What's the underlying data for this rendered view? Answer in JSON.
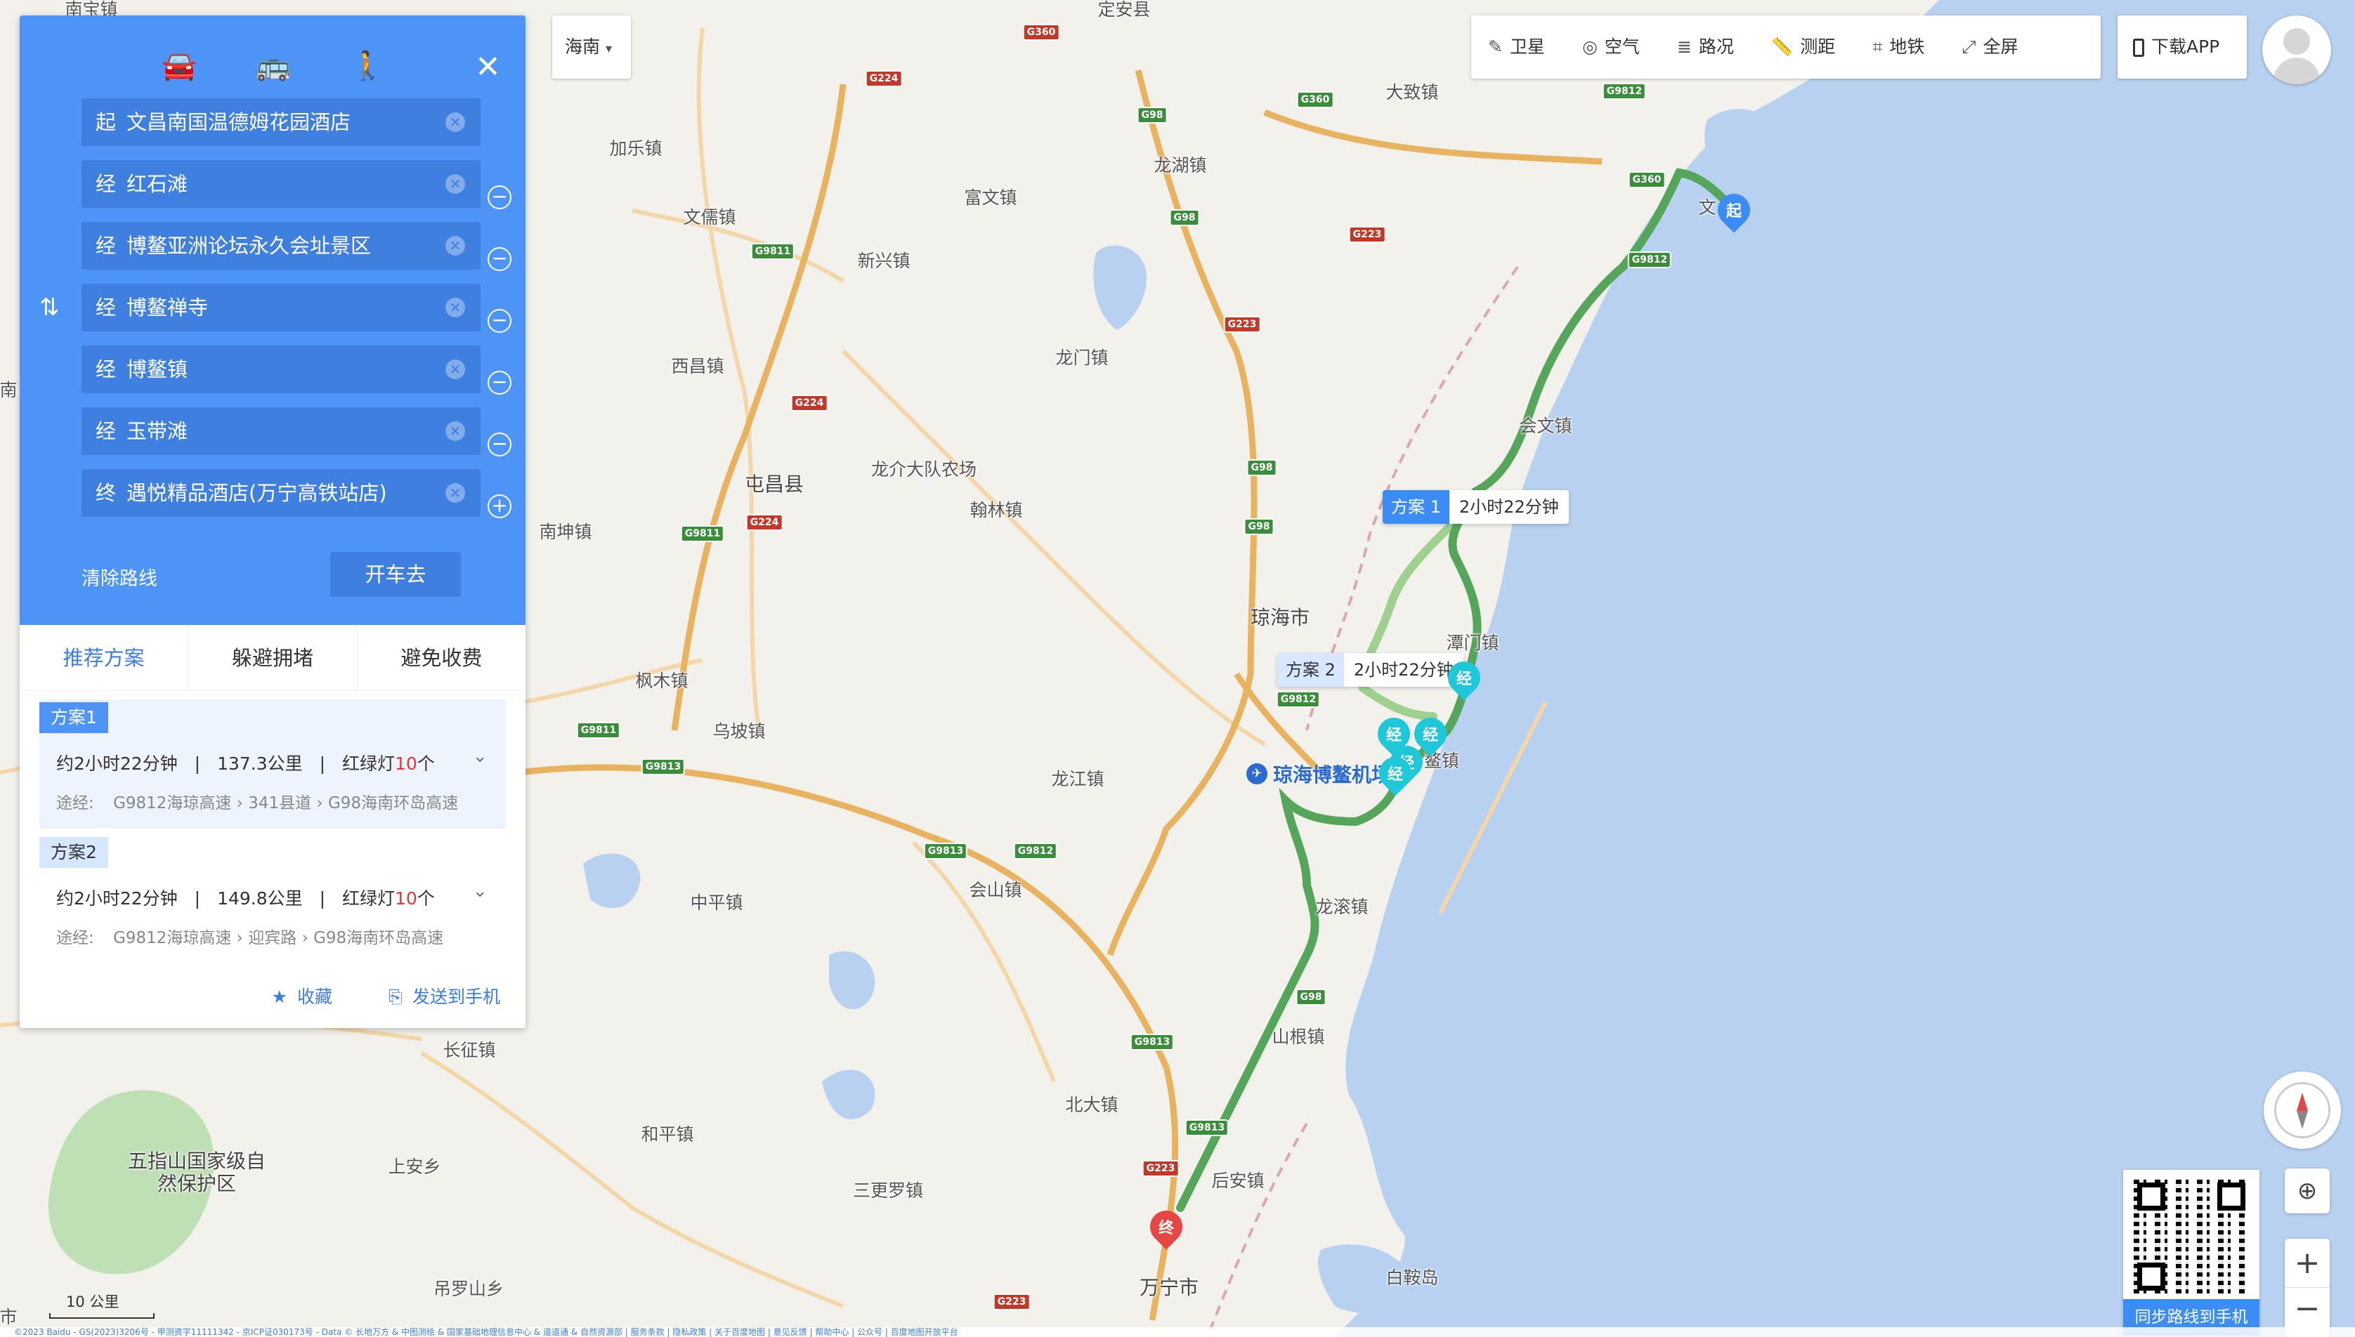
{
  "region_selector": {
    "label": "海南",
    "caret": "▾"
  },
  "toolbar": [
    {
      "label": "卫星",
      "icon": "satellite-icon",
      "glyph": "✎"
    },
    {
      "label": "空气",
      "icon": "air-quality-icon",
      "glyph": "◎"
    },
    {
      "label": "路况",
      "icon": "traffic-icon",
      "glyph": "≣"
    },
    {
      "label": "测距",
      "icon": "ruler-icon",
      "glyph": "📏"
    },
    {
      "label": "地铁",
      "icon": "subway-icon",
      "glyph": "⌗"
    },
    {
      "label": "全屏",
      "icon": "fullscreen-icon",
      "glyph": "⤢"
    }
  ],
  "download_app": "下载APP",
  "panel": {
    "modes": [
      "car",
      "bus",
      "walk"
    ],
    "stops": [
      {
        "prefix": "起",
        "name": "文昌南国温德姆花园酒店",
        "action": ""
      },
      {
        "prefix": "经",
        "name": "红石滩",
        "action": "−"
      },
      {
        "prefix": "经",
        "name": "博鳌亚洲论坛永久会址景区",
        "action": "−"
      },
      {
        "prefix": "经",
        "name": "博鳌禅寺",
        "action": "−"
      },
      {
        "prefix": "经",
        "name": "博鳌镇",
        "action": "−"
      },
      {
        "prefix": "经",
        "name": "玉带滩",
        "action": "−"
      },
      {
        "prefix": "终",
        "name": "遇悦精品酒店(万宁高铁站店)",
        "action": "+"
      }
    ],
    "clear_label": "清除路线",
    "go_label": "开车去",
    "tabs": [
      "推荐方案",
      "躲避拥堵",
      "避免收费"
    ],
    "plans": [
      {
        "badge": "方案1",
        "time": "约2小时22分钟",
        "distance": "137.3公里",
        "lights_prefix": "红绿灯",
        "lights": "10",
        "lights_suffix": "个",
        "via_label": "途经:",
        "via": [
          "G9812海琼高速",
          "341县道",
          "G98海南环岛高速"
        ]
      },
      {
        "badge": "方案2",
        "time": "约2小时22分钟",
        "distance": "149.8公里",
        "lights_prefix": "红绿灯",
        "lights": "10",
        "lights_suffix": "个",
        "via_label": "途经:",
        "via": [
          "G9812海琼高速",
          "迎宾路",
          "G98海南环岛高速"
        ]
      }
    ],
    "favorite_label": "收藏",
    "send_label": "发送到手机"
  },
  "route_tags": [
    {
      "name": "方案 1",
      "time": "2小时22分钟"
    },
    {
      "name": "方案 2",
      "time": "2小时22分钟"
    }
  ],
  "markers": {
    "start": "起",
    "end": "终",
    "via": "经"
  },
  "place_labels": [
    "南宝镇",
    "定安县",
    "大致镇",
    "加乐镇",
    "富文镇",
    "文儒镇",
    "龙湖镇",
    "新兴镇",
    "文",
    "西昌镇",
    "龙门镇",
    "会文镇",
    "屯昌县",
    "龙介大队农场",
    "翰林镇",
    "南坤镇",
    "琼海市",
    "潭门镇",
    "枫木镇",
    "乌坡镇",
    "龙江镇",
    "中平镇",
    "会山镇",
    "龙滚镇",
    "山根镇",
    "长征镇",
    "北大镇",
    "和平镇",
    "上安乡",
    "三更罗镇",
    "后安镇",
    "万宁市",
    "白鞍岛",
    "吊罗山乡",
    "五指山国家级自然保护区",
    "鳌镇",
    "南",
    "市"
  ],
  "airport_label": "琼海博鳌机场",
  "road_shields": [
    "G360",
    "G224",
    "G98",
    "G360",
    "G9812",
    "G360",
    "G9811",
    "G223",
    "G98",
    "G9812",
    "G224",
    "G224",
    "G98",
    "G98",
    "G9811",
    "G223",
    "G9812",
    "G9811",
    "G9813",
    "G9813",
    "G9812",
    "G98",
    "G9813",
    "G9813",
    "G223",
    "G223"
  ],
  "qr_label": "同步路线到手机",
  "scale_label": "10 公里",
  "zoom_in": "+",
  "zoom_out": "−",
  "copyright": "©2023 Baidu - GS(2023)3206号 - 甲测资字11111342 - 京ICP证030173号 - Data © 长地万方 & 中图测绘 & 国家基础地理信息中心 & 道道通 & 自然资源部 | 服务条款 | 隐私政策 | 关于百度地图 | 意见反馈 | 帮助中心 | 公众号 | 百度地图开放平台"
}
